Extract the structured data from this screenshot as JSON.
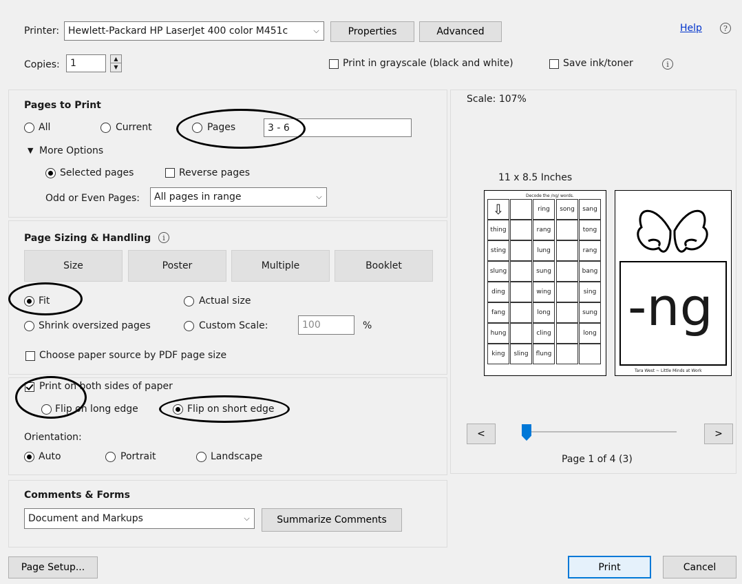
{
  "printer": {
    "label": "Printer:",
    "value": "Hewlett-Packard HP LaserJet 400 color M451c",
    "properties_label": "Properties",
    "advanced_label": "Advanced",
    "help_label": "Help"
  },
  "copies": {
    "label": "Copies:",
    "value": "1"
  },
  "grayscale_label": "Print in grayscale (black and white)",
  "save_ink_label": "Save ink/toner",
  "pages_to_print": {
    "title": "Pages to Print",
    "all_label": "All",
    "current_label": "Current",
    "pages_label": "Pages",
    "pages_value": "3 - 6",
    "more_options_label": "More Options",
    "selected_pages_label": "Selected pages",
    "reverse_pages_label": "Reverse pages",
    "odd_even_label": "Odd or Even Pages:",
    "odd_even_value": "All pages in range"
  },
  "sizing": {
    "title": "Page Sizing & Handling",
    "size_label": "Size",
    "poster_label": "Poster",
    "multiple_label": "Multiple",
    "booklet_label": "Booklet",
    "fit_label": "Fit",
    "actual_size_label": "Actual size",
    "shrink_label": "Shrink oversized pages",
    "custom_scale_label": "Custom Scale:",
    "custom_scale_value": "100",
    "percent_label": "%",
    "paper_source_label": "Choose paper source by PDF page size"
  },
  "duplex": {
    "both_sides_label": "Print on both sides of paper",
    "long_edge_label": "Flip on long edge",
    "short_edge_label": "Flip on short edge",
    "orientation_label": "Orientation:",
    "auto_label": "Auto",
    "portrait_label": "Portrait",
    "landscape_label": "Landscape"
  },
  "comments": {
    "title": "Comments & Forms",
    "value": "Document and Markups",
    "summarize_label": "Summarize Comments"
  },
  "preview": {
    "scale_label": "Scale: 107%",
    "size_label": "11 x 8.5 Inches",
    "worksheet_header": "Decode the /ng/ words.",
    "grid": [
      [
        "",
        "",
        "ring",
        "song",
        "sang"
      ],
      [
        "thing",
        "",
        "rang",
        "",
        "tong"
      ],
      [
        "sting",
        "",
        "lung",
        "",
        "rang"
      ],
      [
        "slung",
        "",
        "sung",
        "",
        "bang"
      ],
      [
        "ding",
        "",
        "wing",
        "",
        "sing"
      ],
      [
        "fang",
        "",
        "long",
        "",
        "sung"
      ],
      [
        "hung",
        "",
        "cling",
        "",
        "long"
      ],
      [
        "king",
        "sling",
        "flung",
        "",
        ""
      ]
    ],
    "card_text": "-ng",
    "credit": "Tara West ~ Little Minds at Work",
    "page_label": "Page 1 of 4 (3)",
    "prev_label": "<",
    "next_label": ">"
  },
  "footer": {
    "page_setup_label": "Page Setup...",
    "print_label": "Print",
    "cancel_label": "Cancel"
  }
}
